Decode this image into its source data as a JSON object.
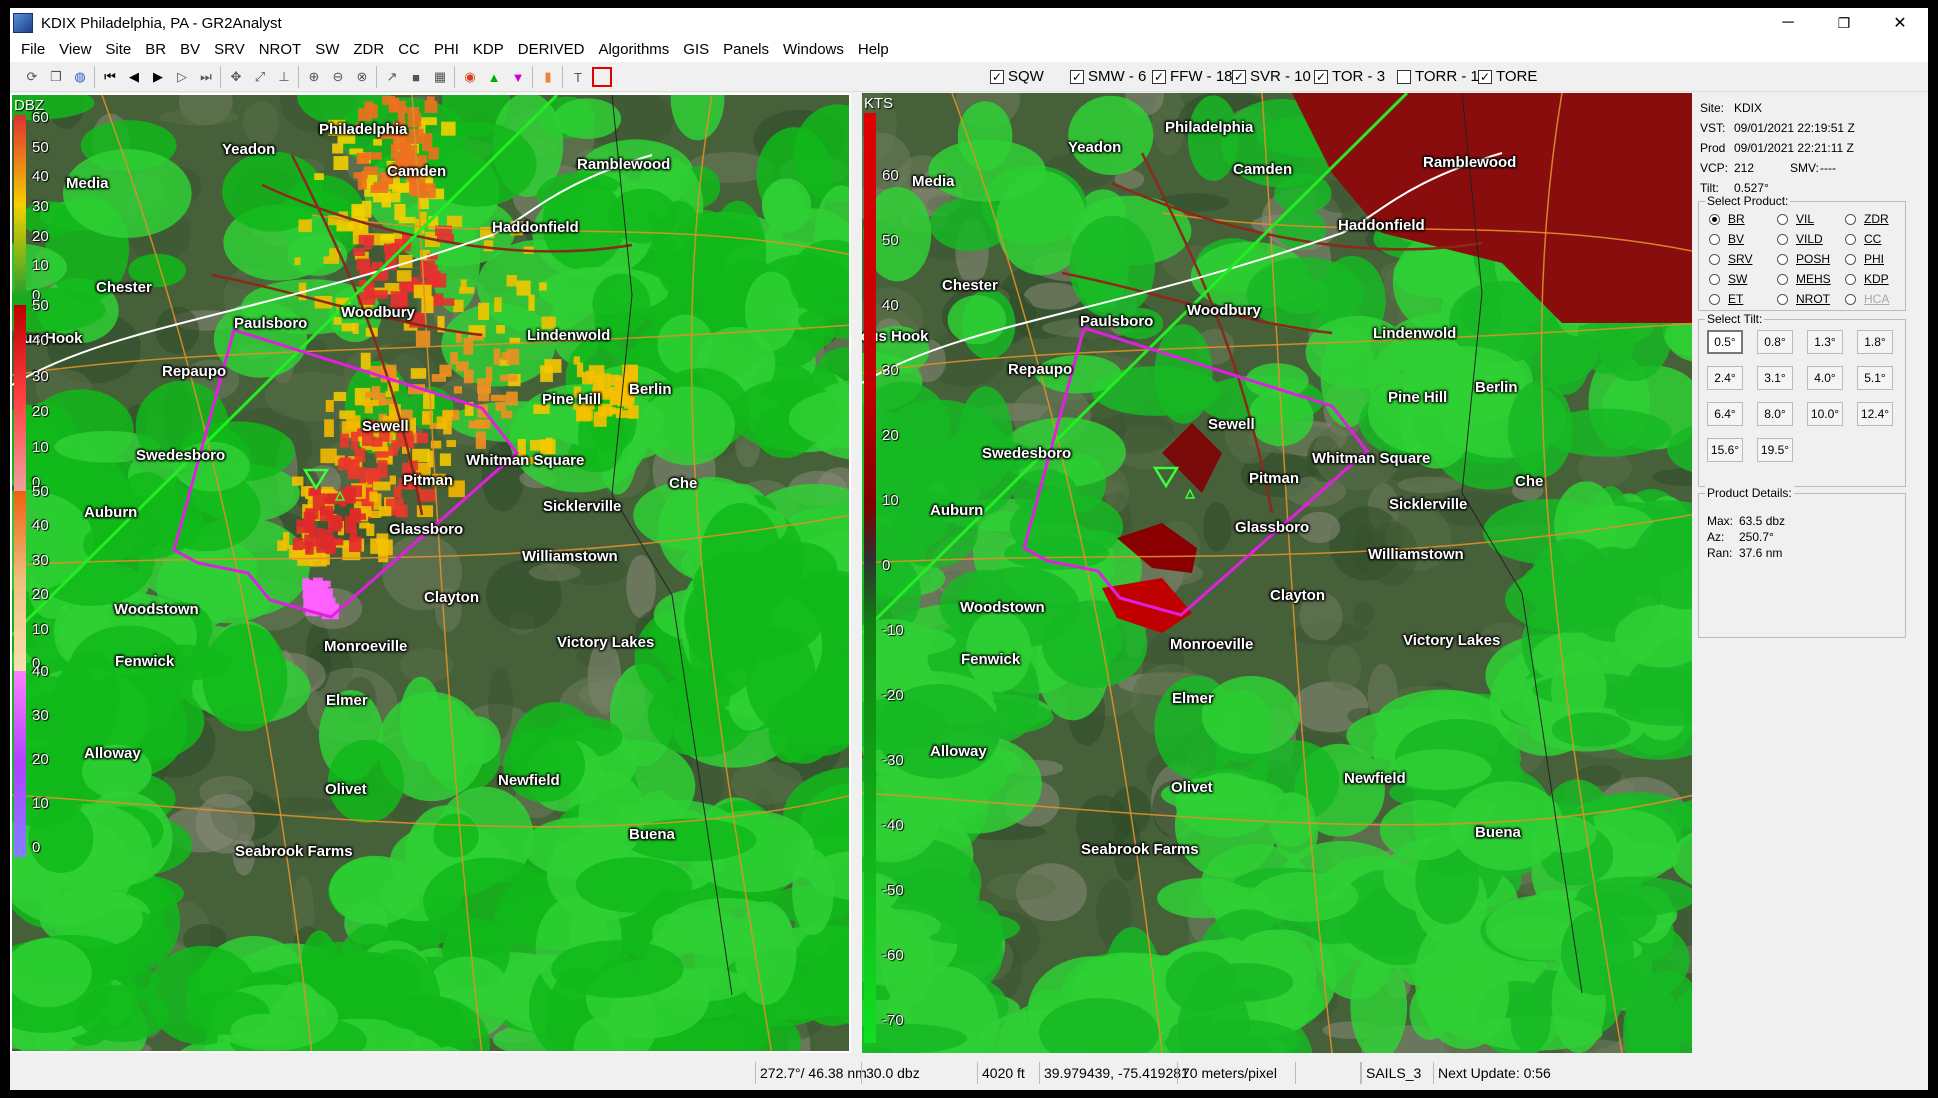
{
  "window": {
    "title": "KDIX Philadelphia, PA - GR2Analyst",
    "controls": {
      "minimize": "─",
      "maximize": "❐",
      "close": "✕"
    }
  },
  "menu": [
    "File",
    "View",
    "Site",
    "BR",
    "BV",
    "SRV",
    "NROT",
    "SW",
    "ZDR",
    "CC",
    "PHI",
    "KDP",
    "DERIVED",
    "Algorithms",
    "GIS",
    "Panels",
    "Windows",
    "Help"
  ],
  "toolbar": {
    "icons": [
      "refresh-icon",
      "copy-icon",
      "globe-icon",
      "skip-start-icon",
      "step-back-icon",
      "play-icon",
      "step-forward-icon",
      "skip-end-icon",
      "pan-icon",
      "measure-icon",
      "cross-section-icon",
      "zoom-in-icon",
      "zoom-out-icon",
      "zoom-reset-icon",
      "arrow-icon",
      "square-icon",
      "grid-icon",
      "storm-icon",
      "triangle-up-icon",
      "triangle-down-icon",
      "color-icon",
      "text-tool-icon",
      "record-icon"
    ],
    "warnings": [
      {
        "label": "SQW",
        "checked": true
      },
      {
        "label": "SMW - 6",
        "checked": true
      },
      {
        "label": "FFW - 18",
        "checked": true
      },
      {
        "label": "SVR - 10",
        "checked": true
      },
      {
        "label": "TOR - 3",
        "checked": true
      },
      {
        "label": "TORR - 1",
        "checked": false
      },
      {
        "label": "TORE",
        "checked": true
      }
    ]
  },
  "left_panel": {
    "unit": "DBZ",
    "scales": [
      {
        "ticks": [
          "60",
          "50",
          "40",
          "30",
          "20",
          "10",
          "0"
        ]
      },
      {
        "ticks": [
          "50",
          "40",
          "30",
          "20",
          "10",
          "0"
        ]
      },
      {
        "ticks": [
          "50",
          "40",
          "30",
          "20",
          "10",
          "0"
        ]
      },
      {
        "ticks": [
          "40",
          "30",
          "20",
          "10",
          "0"
        ]
      }
    ]
  },
  "right_panel": {
    "unit": "KTS",
    "ticks": [
      "60",
      "50",
      "40",
      "30",
      "20",
      "10",
      "0",
      "-10",
      "-20",
      "-30",
      "-40",
      "-50",
      "-60",
      "-70"
    ]
  },
  "cities": [
    {
      "name": "Philadelphia"
    },
    {
      "name": "Yeadon"
    },
    {
      "name": "Camden"
    },
    {
      "name": "Ramblewood"
    },
    {
      "name": "Media"
    },
    {
      "name": "Haddonfield"
    },
    {
      "name": "Chester"
    },
    {
      "name": "Woodbury"
    },
    {
      "name": "Paulsboro"
    },
    {
      "name": "Lindenwold"
    },
    {
      "name": "Hook"
    },
    {
      "name": "Repaupo"
    },
    {
      "name": "Pine Hill"
    },
    {
      "name": "Berlin"
    },
    {
      "name": "Sewell"
    },
    {
      "name": "Swedesboro"
    },
    {
      "name": "Whitman Square"
    },
    {
      "name": "Pitman"
    },
    {
      "name": "Che"
    },
    {
      "name": "Auburn"
    },
    {
      "name": "Sicklerville"
    },
    {
      "name": "Glassboro"
    },
    {
      "name": "Williamstown"
    },
    {
      "name": "Woodstown"
    },
    {
      "name": "Clayton"
    },
    {
      "name": "Victory Lakes"
    },
    {
      "name": "Monroeville"
    },
    {
      "name": "Fenwick"
    },
    {
      "name": "Elmer"
    },
    {
      "name": "Alloway"
    },
    {
      "name": "Olivet"
    },
    {
      "name": "Newfield"
    },
    {
      "name": "Buena"
    },
    {
      "name": "Seabrook Farms"
    }
  ],
  "right_cities_hook": "cus Hook",
  "left_cities_hook": "cus Hook",
  "side": {
    "info": [
      {
        "label": "Site:",
        "value": "KDIX"
      },
      {
        "label": "VST:",
        "value": "09/01/2021  22:19:51 Z"
      },
      {
        "label": "Prod",
        "value": "09/01/2021  22:21:11 Z"
      },
      {
        "label": "VCP:",
        "value": "212"
      },
      {
        "label": "Tilt:",
        "value": "0.527°"
      }
    ],
    "smv_label": "SMV:",
    "smv_value": "----",
    "select_product_title": "Select Product:",
    "products": [
      {
        "label": "BR",
        "selected": true
      },
      {
        "label": "VIL"
      },
      {
        "label": "ZDR"
      },
      {
        "label": "BV"
      },
      {
        "label": "VILD"
      },
      {
        "label": "CC"
      },
      {
        "label": "SRV"
      },
      {
        "label": "POSH"
      },
      {
        "label": "PHI"
      },
      {
        "label": "SW"
      },
      {
        "label": "MEHS"
      },
      {
        "label": "KDP"
      },
      {
        "label": "ET"
      },
      {
        "label": "NROT"
      },
      {
        "label": "HCA",
        "disabled": true
      }
    ],
    "select_tilt_title": "Select Tilt:",
    "tilts": [
      "0.5°",
      "0.8°",
      "1.3°",
      "1.8°",
      "2.4°",
      "3.1°",
      "4.0°",
      "5.1°",
      "6.4°",
      "8.0°",
      "10.0°",
      "12.4°",
      "15.6°",
      "19.5°"
    ],
    "details_title": "Product Details:",
    "details": [
      {
        "label": "Max:",
        "value": "63.5 dbz"
      },
      {
        "label": "Az:",
        "value": "250.7°"
      },
      {
        "label": "Ran:",
        "value": "37.6 nm"
      }
    ]
  },
  "status": {
    "azran": "272.7°/ 46.38 nm",
    "value": "30.0 dbz",
    "height": "4020 ft",
    "coords": "39.979439, -75.419281",
    "resolution": "70 meters/pixel",
    "mode": "SAILS_3",
    "next_update": "Next Update: 0:56"
  }
}
